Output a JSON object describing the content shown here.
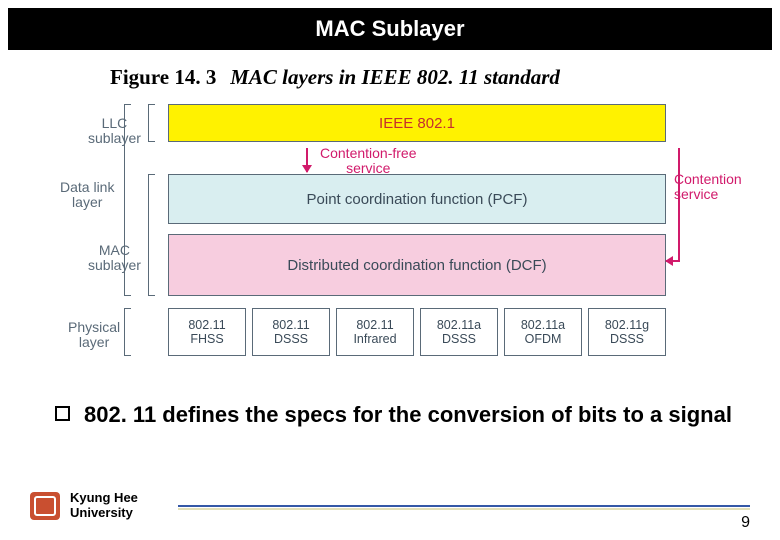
{
  "title": "MAC Sublayer",
  "figure": {
    "number": "Figure 14. 3",
    "caption": "MAC layers in IEEE 802. 11 standard"
  },
  "layer_labels": {
    "llc": "LLC\nsublayer",
    "data_link": "Data link\nlayer",
    "mac": "MAC\nsublayer",
    "physical": "Physical\nlayer"
  },
  "boxes": {
    "ieee": "IEEE 802.1",
    "pcf": "Point coordination function (PCF)",
    "dcf": "Distributed coordination function (DCF)"
  },
  "arrows": {
    "contention_free": "Contention-free\nservice",
    "contention": "Contention\nservice"
  },
  "physical_cells": [
    {
      "line1": "802.11",
      "line2": "FHSS"
    },
    {
      "line1": "802.11",
      "line2": "DSSS"
    },
    {
      "line1": "802.11",
      "line2": "Infrared"
    },
    {
      "line1": "802.11a",
      "line2": "DSSS"
    },
    {
      "line1": "802.11a",
      "line2": "OFDM"
    },
    {
      "line1": "802.11g",
      "line2": "DSSS"
    }
  ],
  "bullet": "802. 11 defines the specs for the conversion of bits to a signal",
  "footer": {
    "university_line1": "Kyung Hee",
    "university_line2": "University",
    "page": "9"
  }
}
